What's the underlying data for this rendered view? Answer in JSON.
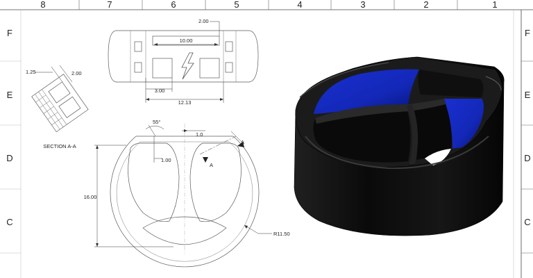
{
  "border": {
    "columns": [
      "8",
      "7",
      "6",
      "5",
      "4",
      "3",
      "2",
      "1"
    ],
    "rows": [
      "F",
      "E",
      "D",
      "C"
    ]
  },
  "top_view": {
    "dims": [
      "2.00",
      "10.00",
      "3.00",
      "12.13"
    ],
    "symbol": "lightning-bolt"
  },
  "section_view": {
    "dims": [
      "1.25",
      "2.00"
    ],
    "caption": "SECTION A-A"
  },
  "front_view": {
    "dims": [
      "55°",
      "1.0",
      "1.00",
      "16.00",
      "R11.50"
    ],
    "section_marks": [
      "A",
      "A"
    ]
  },
  "render": {
    "body_color": "#0b0b0b",
    "inner_color": "#1a2fd0"
  }
}
